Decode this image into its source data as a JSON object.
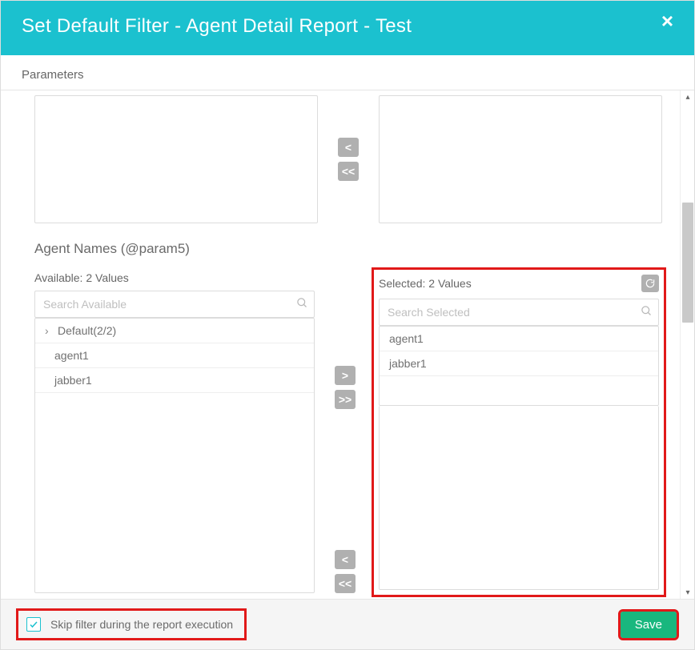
{
  "header": {
    "title": "Set Default Filter - Agent Detail Report - Test"
  },
  "tabs": {
    "parameters": "Parameters"
  },
  "agentNames": {
    "label": "Agent Names (@param5)",
    "available": {
      "header": "Available: 2 Values",
      "placeholder": "Search Available",
      "groupLabel": "Default(2/2)",
      "items": [
        "agent1",
        "jabber1"
      ]
    },
    "selected": {
      "header": "Selected: 2 Values",
      "placeholder": "Search Selected",
      "items": [
        "agent1",
        "jabber1"
      ]
    }
  },
  "transfer": {
    "moveLeft": "<",
    "moveAllLeft": "<<",
    "moveRight": ">",
    "moveAllRight": ">>"
  },
  "footer": {
    "skip": "Skip filter during the report execution",
    "save": "Save"
  }
}
